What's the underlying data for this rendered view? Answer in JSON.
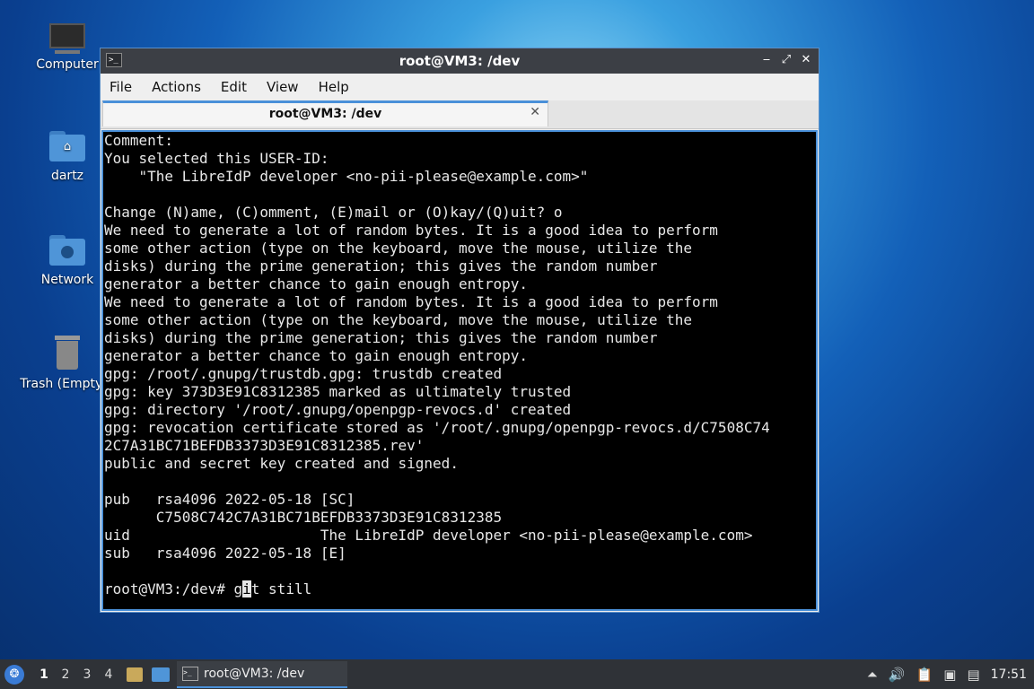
{
  "desktop": {
    "icons": [
      {
        "label": "Computer",
        "icon": "computer-icon"
      },
      {
        "label": "dartz",
        "icon": "home-folder-icon"
      },
      {
        "label": "Network",
        "icon": "network-folder-icon"
      },
      {
        "label": "Trash (Empty)",
        "icon": "trash-icon"
      }
    ]
  },
  "window": {
    "title": "root@VM3: /dev",
    "menu": [
      "File",
      "Actions",
      "Edit",
      "View",
      "Help"
    ],
    "tab_title": "root@VM3: /dev",
    "terminal": {
      "lines": [
        "Comment:",
        "You selected this USER-ID:",
        "    \"The LibreIdP developer <no-pii-please@example.com>\"",
        "",
        "Change (N)ame, (C)omment, (E)mail or (O)kay/(Q)uit? o",
        "We need to generate a lot of random bytes. It is a good idea to perform",
        "some other action (type on the keyboard, move the mouse, utilize the",
        "disks) during the prime generation; this gives the random number",
        "generator a better chance to gain enough entropy.",
        "We need to generate a lot of random bytes. It is a good idea to perform",
        "some other action (type on the keyboard, move the mouse, utilize the",
        "disks) during the prime generation; this gives the random number",
        "generator a better chance to gain enough entropy.",
        "gpg: /root/.gnupg/trustdb.gpg: trustdb created",
        "gpg: key 373D3E91C8312385 marked as ultimately trusted",
        "gpg: directory '/root/.gnupg/openpgp-revocs.d' created",
        "gpg: revocation certificate stored as '/root/.gnupg/openpgp-revocs.d/C7508C74",
        "2C7A31BC71BEFDB3373D3E91C8312385.rev'",
        "public and secret key created and signed.",
        "",
        "pub   rsa4096 2022-05-18 [SC]",
        "      C7508C742C7A31BC71BEFDB3373D3E91C8312385",
        "uid                      The LibreIdP developer <no-pii-please@example.com>",
        "sub   rsa4096 2022-05-18 [E]",
        ""
      ],
      "prompt": "root@VM3:/dev# ",
      "input_before_cursor": "g",
      "input_cursor_char": "i",
      "input_after_cursor": "t still"
    }
  },
  "taskbar": {
    "workspaces": [
      "1",
      "2",
      "3",
      "4"
    ],
    "active_workspace": "1",
    "task_title": "root@VM3: /dev",
    "clock": "17:51"
  }
}
